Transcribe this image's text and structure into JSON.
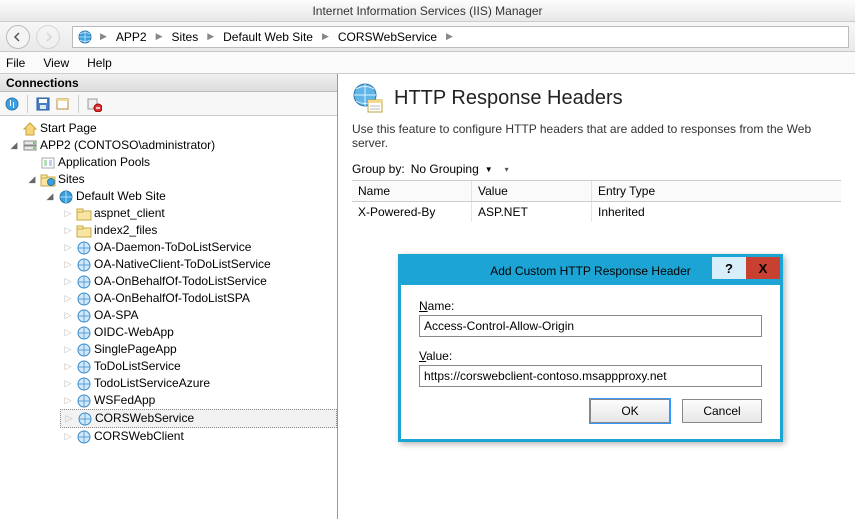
{
  "window": {
    "title": "Internet Information Services (IIS) Manager"
  },
  "breadcrumb": [
    "APP2",
    "Sites",
    "Default Web Site",
    "CORSWebService"
  ],
  "menu": {
    "file": "File",
    "view": "View",
    "help": "Help"
  },
  "connections": {
    "header": "Connections"
  },
  "tree": {
    "start": "Start Page",
    "server": "APP2 (CONTOSO\\administrator)",
    "appPools": "Application Pools",
    "sites": "Sites",
    "defaultSite": "Default Web Site",
    "apps": [
      "aspnet_client",
      "index2_files",
      "OA-Daemon-ToDoListService",
      "OA-NativeClient-ToDoListService",
      "OA-OnBehalfOf-TodoListService",
      "OA-OnBehalfOf-TodoListSPA",
      "OA-SPA",
      "OIDC-WebApp",
      "SinglePageApp",
      "ToDoListService",
      "TodoListServiceAzure",
      "WSFedApp",
      "CORSWebService",
      "CORSWebClient"
    ],
    "selectedIndex": 12
  },
  "feature": {
    "title": "HTTP Response Headers",
    "desc": "Use this feature to configure HTTP headers that are added to responses from the Web server.",
    "groupByLabel": "Group by:",
    "groupByValue": "No Grouping",
    "columns": {
      "name": "Name",
      "value": "Value",
      "entry": "Entry Type"
    },
    "rows": [
      {
        "name": "X-Powered-By",
        "value": "ASP.NET",
        "entry": "Inherited"
      }
    ]
  },
  "dialog": {
    "title": "Add Custom HTTP Response Header",
    "nameLabel": "Name:",
    "nameValue": "Access-Control-Allow-Origin",
    "valueLabel": "Value:",
    "valueValue": "https://corswebclient-contoso.msappproxy.net",
    "ok": "OK",
    "cancel": "Cancel"
  }
}
